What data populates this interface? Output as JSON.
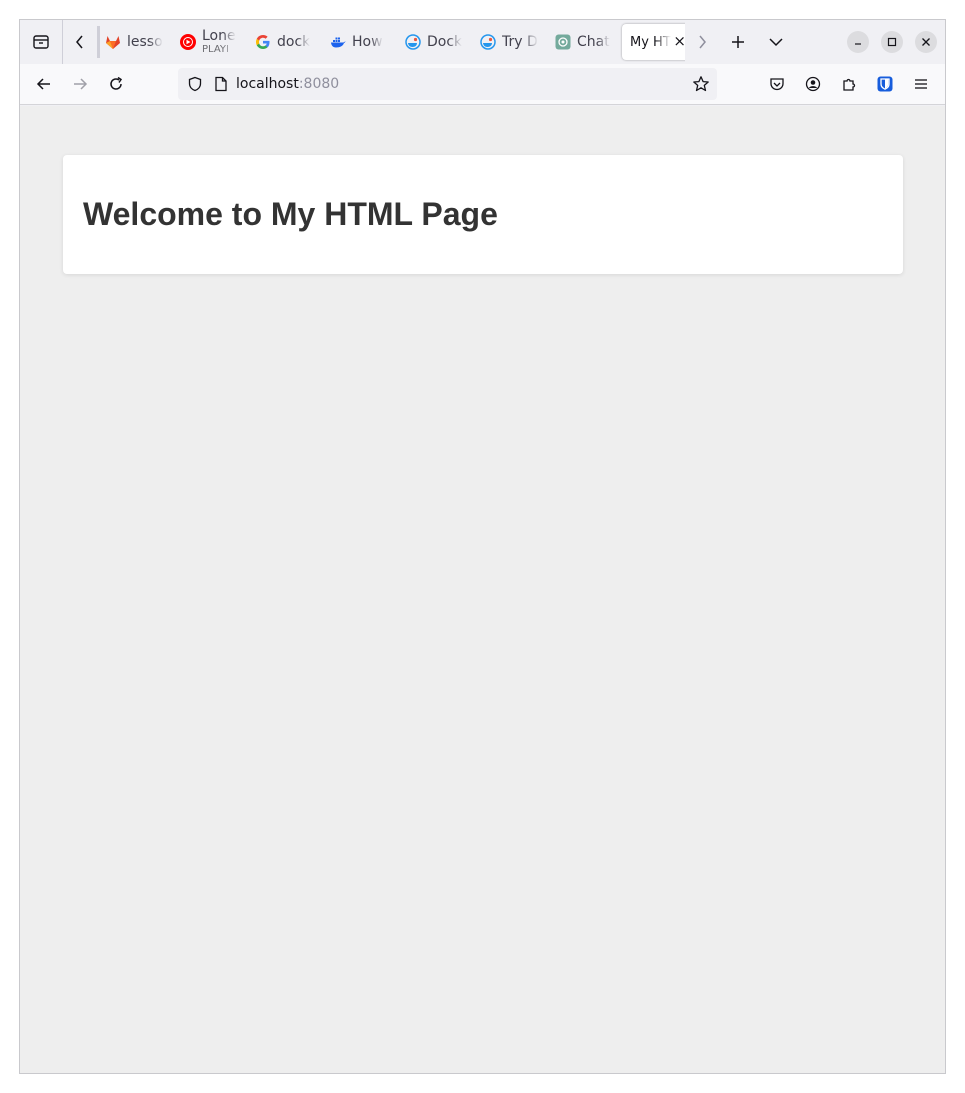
{
  "browser": {
    "tabs": [
      {
        "label": "lesso",
        "favicon": "gitlab-icon"
      },
      {
        "label": "Lone",
        "sublabel": "PLAYI",
        "favicon": "youtube-music-icon"
      },
      {
        "label": "dock",
        "favicon": "google-icon"
      },
      {
        "label": "How",
        "favicon": "docker-icon"
      },
      {
        "label": "Dock",
        "favicon": "docker-labs-icon"
      },
      {
        "label": "Try D",
        "favicon": "docker-labs-icon"
      },
      {
        "label": "Chat",
        "favicon": "chatgpt-icon"
      },
      {
        "label": "My HT",
        "favicon": "",
        "active": true
      }
    ],
    "url": {
      "host": "localhost",
      "port": ":8080"
    }
  },
  "page": {
    "heading": "Welcome to My HTML Page"
  },
  "colors": {
    "chrome": "#f0f0f4",
    "navbar": "#f9f9fb",
    "viewport": "#eeeeee",
    "card": "#ffffff",
    "heading": "#333333",
    "bitwarden": "#175ddc"
  }
}
